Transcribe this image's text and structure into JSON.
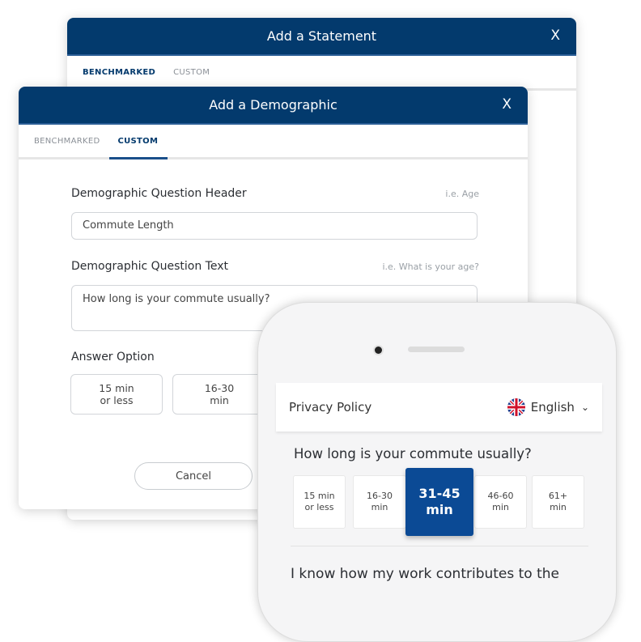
{
  "statement_dialog": {
    "title": "Add a Statement",
    "close": "X",
    "tabs": [
      {
        "label": "BENCHMARKED",
        "active": true
      },
      {
        "label": "CUSTOM",
        "active": false
      }
    ]
  },
  "demographic_dialog": {
    "title": "Add a Demographic",
    "close": "X",
    "tabs": [
      {
        "label": "BENCHMARKED",
        "active": false
      },
      {
        "label": "CUSTOM",
        "active": true
      }
    ],
    "header_label": "Demographic Question Header",
    "header_hint": "i.e. Age",
    "header_value": "Commute Length",
    "text_label": "Demographic Question Text",
    "text_hint": "i.e. What is your age?",
    "text_value": "How long is your commute usually?",
    "answer_label": "Answer Option",
    "answers": [
      {
        "line1": "15 min",
        "line2": "or less"
      },
      {
        "line1": "16-30",
        "line2": "min"
      }
    ],
    "cancel": "Cancel"
  },
  "phone": {
    "privacy": "Privacy Policy",
    "language": "English",
    "flag_icon": "uk-flag-icon",
    "question": "How long is your commute usually?",
    "options": [
      {
        "line1": "15 min",
        "line2": "or less",
        "selected": false
      },
      {
        "line1": "16-30",
        "line2": "min",
        "selected": false
      },
      {
        "line1": "31-45",
        "line2": "min",
        "selected": true
      },
      {
        "line1": "46-60",
        "line2": "min",
        "selected": false
      },
      {
        "line1": "61+",
        "line2": "min",
        "selected": false
      }
    ],
    "next_question": "I know how my work contributes to the"
  },
  "colors": {
    "header": "#033a6d",
    "selected": "#0b4a95"
  }
}
